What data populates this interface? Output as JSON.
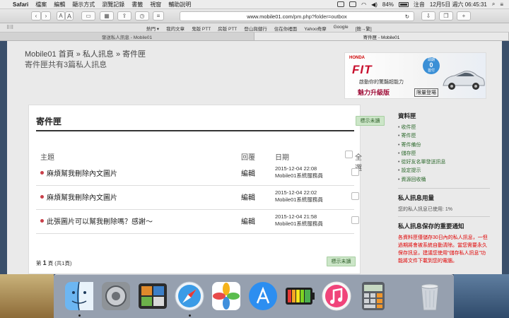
{
  "menubar": {
    "app_name": "Safari",
    "menus": [
      "檔案",
      "編輯",
      "顯示方式",
      "瀏覽記錄",
      "書籤",
      "視窗",
      "輔助說明"
    ],
    "battery": "84%",
    "input_method": "注音",
    "datetime": "12月5日 週六 06:45:31"
  },
  "toolbar": {
    "address_host": "www.mobile01.com",
    "address_path": "/pm.php?folder=outbox",
    "font_small": "A",
    "font_large": "A"
  },
  "favorites": {
    "items": [
      "熱門 ▾",
      "我的文章",
      "鬼版 PTT",
      "房版 PTT",
      "登山與健行",
      "住在你裡面",
      "Yahoo奇摩",
      "Google",
      "[簡→繁]"
    ]
  },
  "tabs": [
    {
      "label": "發送私人訊息 - Mobile01",
      "active": false
    },
    {
      "label": "寄件匣 - Mobile01",
      "active": true
    }
  ],
  "page": {
    "breadcrumb": "Mobile01 首頁 » 私人訊息 » 寄件匣",
    "summary": "寄件匣共有3篇私人訊息",
    "banner": {
      "brand": "HONDA",
      "model": "FIT",
      "tagline": "啟動你的驚豔超能力",
      "edition": "魅力升級版",
      "cta": "限量登場",
      "badge_top": "頭期",
      "badge_mid": "0",
      "badge_bot": "首付"
    },
    "main": {
      "title": "寄件匣",
      "mark_unread": "標示未讀",
      "col_subject": "主題",
      "col_reply": "回覆",
      "col_date": "日期",
      "col_select_all": "全選",
      "rows": [
        {
          "subject": "麻煩幫我刪除內文圖片",
          "reply": "編輯",
          "date": "2015-12-04 22:08",
          "sender": "Mobile01系統服務員"
        },
        {
          "subject": "麻煩幫我刪除內文圖片",
          "reply": "編輯",
          "date": "2015-12-04 22:02",
          "sender": "Mobile01系統服務員"
        },
        {
          "subject": "此張圖片可以幫我刪除嗎？感謝～",
          "reply": "編輯",
          "date": "2015-12-04 21:58",
          "sender": "Mobile01系統服務員"
        }
      ],
      "pager_prefix": "第",
      "pager_page": "1",
      "pager_suffix": "頁 (共1頁)"
    },
    "sidebar": {
      "folders_title": "資料匣",
      "folders": [
        "收件匣",
        "寄件匣",
        "寄件備份",
        "儲存匣",
        "從好友名單發送訊息",
        "設定提示",
        "資源回收桶"
      ],
      "usage_title": "私人訊息用量",
      "usage_text": "您的私人訊息已使用: 1%",
      "notice_title": "私人訊息保存的重要通知",
      "notice_text": "各資料匣僅儲存30日內的私人訊息，一但過期將會被系統自動清除。當您需要永久保存訊息，建議您使用\"儲存私人訊息\"功能將文件下載到您的電腦。"
    }
  },
  "dock": {
    "apps": [
      "finder-icon",
      "system-preferences-icon",
      "activity-icon",
      "safari-icon",
      "photos-icon",
      "app-store-icon",
      "battery-app-icon",
      "itunes-icon",
      "calculator-icon",
      "trash-icon"
    ]
  }
}
